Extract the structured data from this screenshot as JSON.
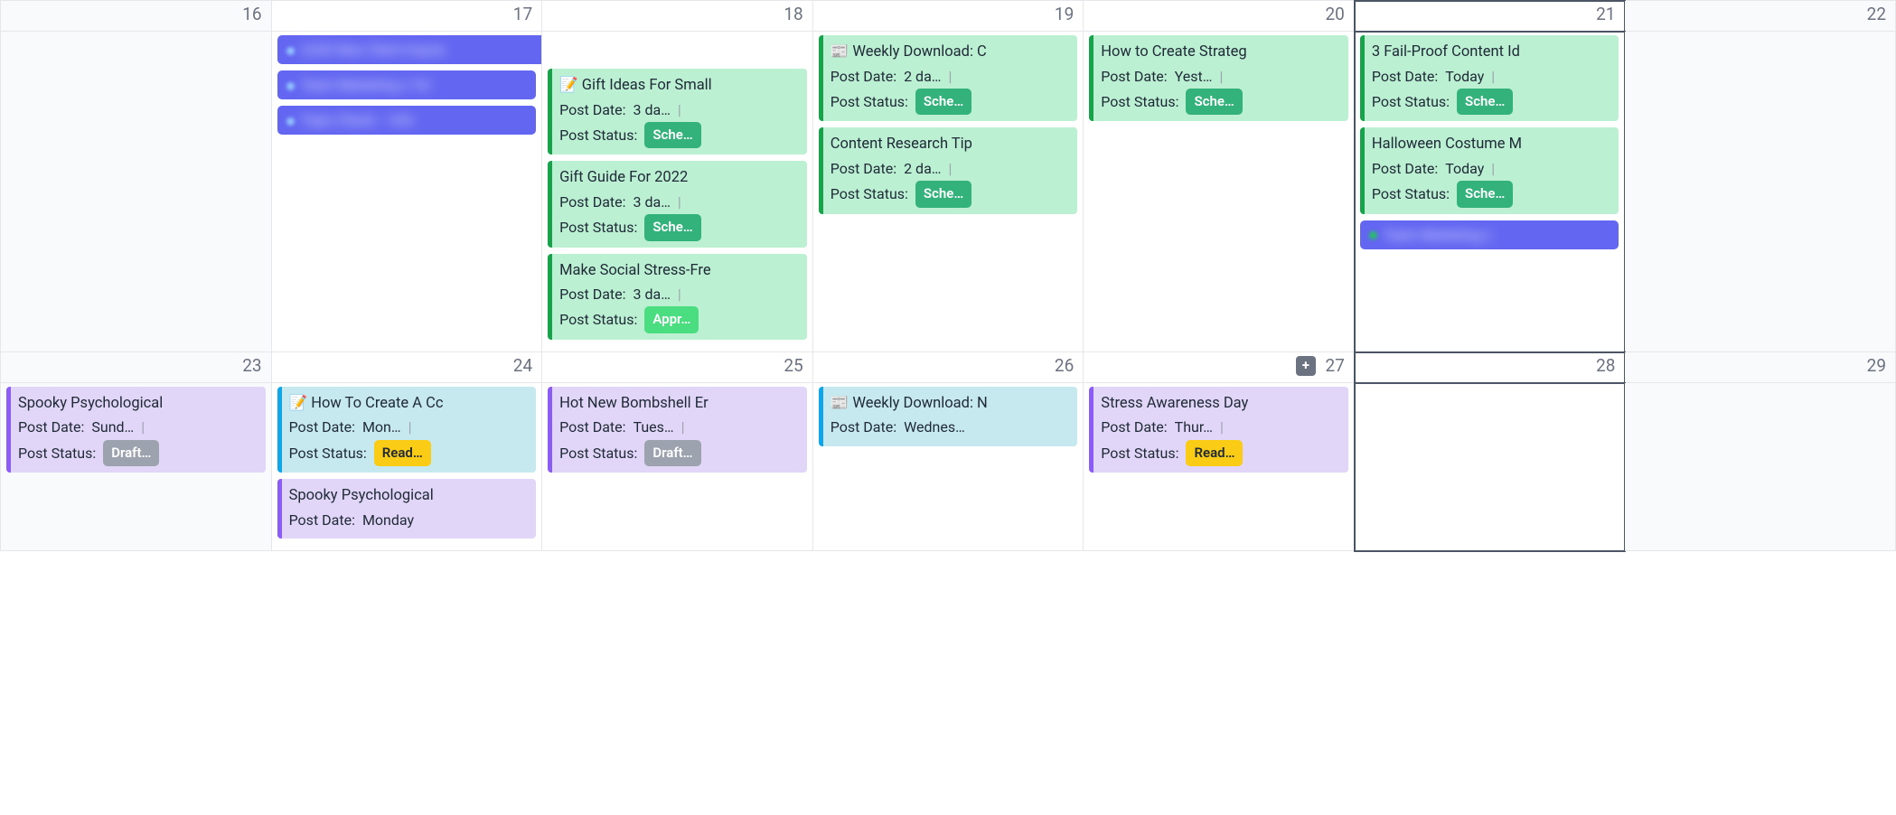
{
  "labels": {
    "post_date": "Post Date:",
    "post_status": "Post Status:",
    "add": "+"
  },
  "statuses": {
    "scheduled": "Sche…",
    "approved": "Appr…",
    "drafting": "Draft…",
    "ready": "Read…"
  },
  "redacted": {
    "bar1": "LEAD   New Client Inquiry",
    "bar2": "Team Marketing x Txt",
    "bar3": "Topic Check – Info",
    "bar4": "Team Marketing x"
  },
  "cells": {
    "16": {
      "date": "16"
    },
    "17": {
      "date": "17",
      "redacted": [
        "bar1",
        "bar2",
        "bar3"
      ]
    },
    "18": {
      "date": "18",
      "events": [
        {
          "title": "📝 Gift Ideas For Small",
          "date": "3 da…",
          "status": "scheduled",
          "theme": "green"
        },
        {
          "title": "Gift Guide For 2022",
          "date": "3 da…",
          "status": "scheduled",
          "theme": "green"
        },
        {
          "title": "Make Social Stress-Fre",
          "date": "3 da…",
          "status": "approved",
          "theme": "green"
        }
      ]
    },
    "19": {
      "date": "19",
      "events": [
        {
          "title": "📰 Weekly Download: C",
          "date": "2 da…",
          "status": "scheduled",
          "theme": "green"
        },
        {
          "title": "Content Research Tip",
          "date": "2 da…",
          "status": "scheduled",
          "theme": "green"
        }
      ]
    },
    "20": {
      "date": "20",
      "events": [
        {
          "title": "How to Create Strateg",
          "date": "Yest…",
          "status": "scheduled",
          "theme": "green"
        }
      ]
    },
    "21": {
      "date": "21",
      "today": true,
      "events": [
        {
          "title": "3 Fail-Proof Content Id",
          "date": "Today",
          "status": "scheduled",
          "theme": "green"
        },
        {
          "title": "Halloween Costume M",
          "date": "Today",
          "status": "scheduled",
          "theme": "green"
        }
      ],
      "redacted_after": [
        "bar4"
      ]
    },
    "22": {
      "date": "22"
    },
    "23": {
      "date": "23",
      "events": [
        {
          "title": "Spooky Psychological",
          "date": "Sund…",
          "status": "drafting",
          "theme": "purple"
        }
      ]
    },
    "24": {
      "date": "24",
      "events": [
        {
          "title": "📝 How To Create A Cc",
          "date": "Mon…",
          "status": "ready",
          "theme": "blue"
        },
        {
          "title": "Spooky Psychological",
          "date": "Monday",
          "theme": "purple"
        }
      ]
    },
    "25": {
      "date": "25",
      "events": [
        {
          "title": "Hot New Bombshell Er",
          "date": "Tues…",
          "status": "drafting",
          "theme": "purple"
        }
      ]
    },
    "26": {
      "date": "26",
      "events": [
        {
          "title": "📰 Weekly Download: N",
          "date": "Wednes…",
          "theme": "blue"
        }
      ]
    },
    "27": {
      "date": "27",
      "show_add": true,
      "events": [
        {
          "title": "Stress Awareness Day",
          "date": "Thur…",
          "status": "ready",
          "theme": "purple"
        }
      ]
    },
    "28": {
      "date": "28"
    },
    "29": {
      "date": "29"
    }
  }
}
